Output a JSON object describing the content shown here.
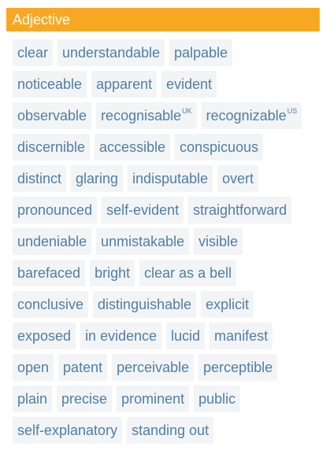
{
  "header": {
    "title": "Adjective"
  },
  "chips": {
    "rows": [
      [
        {
          "label": "clear"
        },
        {
          "label": "understandable"
        },
        {
          "label": "palpable"
        }
      ],
      [
        {
          "label": "noticeable"
        },
        {
          "label": "apparent"
        },
        {
          "label": "evident"
        }
      ],
      [
        {
          "label": "observable"
        },
        {
          "label": "recognisable",
          "sup": "UK"
        },
        {
          "label": "recognizable",
          "sup": "US"
        }
      ],
      [
        {
          "label": "discernible"
        },
        {
          "label": "accessible"
        },
        {
          "label": "conspicuous"
        }
      ],
      [
        {
          "label": "distinct"
        },
        {
          "label": "glaring"
        },
        {
          "label": "indisputable"
        },
        {
          "label": "overt"
        }
      ],
      [
        {
          "label": "pronounced"
        },
        {
          "label": "self-evident"
        },
        {
          "label": "straightforward"
        }
      ],
      [
        {
          "label": "undeniable"
        },
        {
          "label": "unmistakable"
        },
        {
          "label": "visible"
        }
      ],
      [
        {
          "label": "barefaced"
        },
        {
          "label": "bright"
        },
        {
          "label": "clear as a bell"
        }
      ],
      [
        {
          "label": "conclusive"
        },
        {
          "label": "distinguishable"
        },
        {
          "label": "explicit"
        }
      ],
      [
        {
          "label": "exposed"
        },
        {
          "label": "in evidence"
        },
        {
          "label": "lucid"
        },
        {
          "label": "manifest"
        }
      ],
      [
        {
          "label": "open"
        },
        {
          "label": "patent"
        },
        {
          "label": "perceivable"
        },
        {
          "label": "perceptible"
        }
      ],
      [
        {
          "label": "plain"
        },
        {
          "label": "precise"
        },
        {
          "label": "prominent"
        },
        {
          "label": "public"
        }
      ],
      [
        {
          "label": "self-explanatory"
        },
        {
          "label": "standing out"
        }
      ]
    ]
  },
  "colors": {
    "header_bg": "#f7a823",
    "header_text": "#ffffff",
    "chip_bg": "#f3f4f5",
    "chip_text": "#4f7fa6"
  }
}
